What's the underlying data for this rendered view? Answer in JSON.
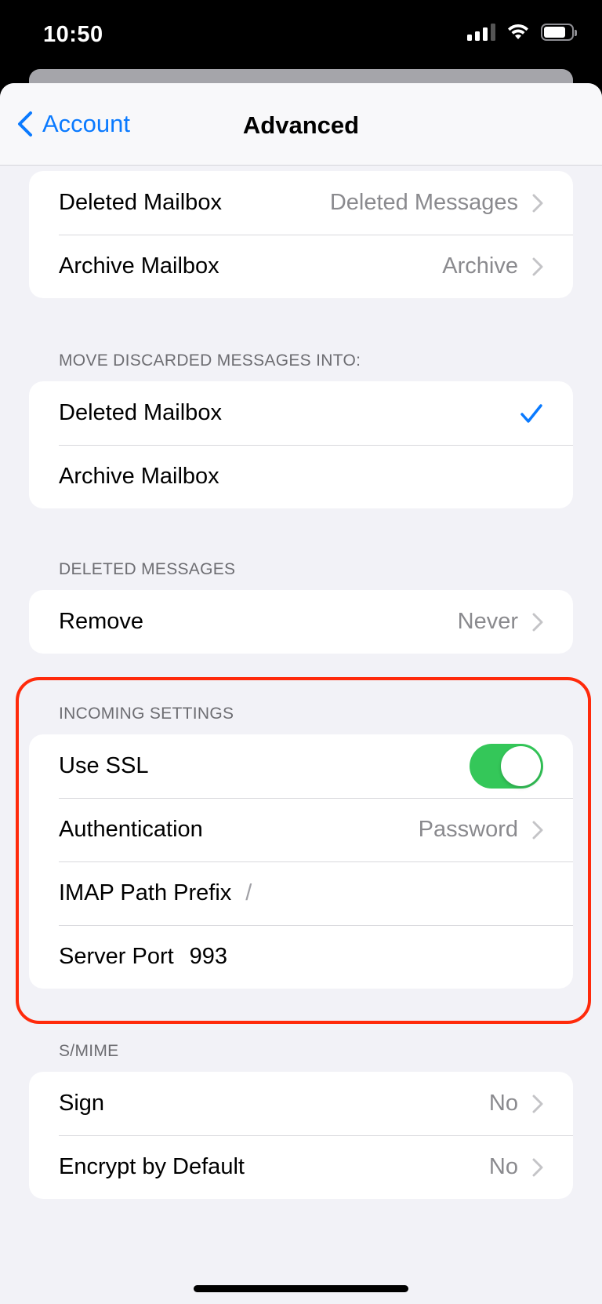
{
  "status_bar": {
    "time": "10:50",
    "battery_level": 0.8
  },
  "nav": {
    "back_label": "Account",
    "title": "Advanced"
  },
  "mailbox_behaviors": {
    "rows": [
      {
        "label": "Deleted Mailbox",
        "value": "Deleted Messages"
      },
      {
        "label": "Archive Mailbox",
        "value": "Archive"
      }
    ]
  },
  "discard": {
    "header": "MOVE DISCARDED MESSAGES INTO:",
    "rows": [
      {
        "label": "Deleted Mailbox",
        "selected": true
      },
      {
        "label": "Archive Mailbox",
        "selected": false
      }
    ]
  },
  "deleted_messages": {
    "header": "DELETED MESSAGES",
    "rows": [
      {
        "label": "Remove",
        "value": "Never"
      }
    ]
  },
  "incoming": {
    "header": "INCOMING SETTINGS",
    "use_ssl": {
      "label": "Use SSL",
      "enabled": true
    },
    "authentication": {
      "label": "Authentication",
      "value": "Password"
    },
    "imap_prefix": {
      "label": "IMAP Path Prefix",
      "value": "/"
    },
    "server_port": {
      "label": "Server Port",
      "value": "993"
    }
  },
  "smime": {
    "header": "S/MIME",
    "rows": [
      {
        "label": "Sign",
        "value": "No"
      },
      {
        "label": "Encrypt by Default",
        "value": "No"
      }
    ]
  },
  "colors": {
    "accent": "#0a7aff",
    "toggle_on": "#34c759",
    "highlight": "#ff2a0b",
    "background": "#f2f2f7"
  }
}
